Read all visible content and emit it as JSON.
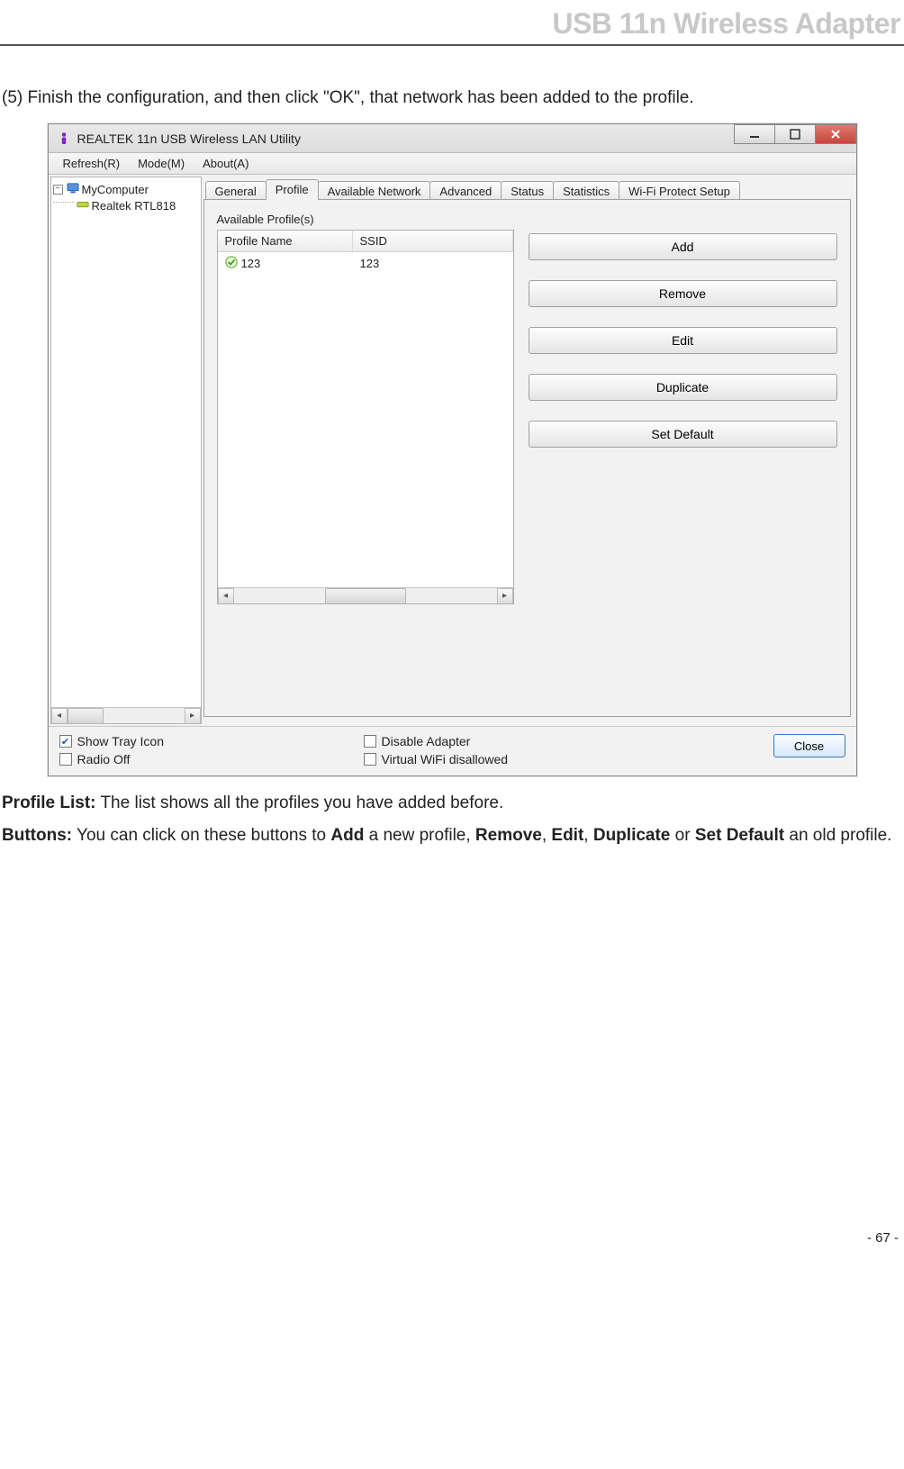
{
  "doc": {
    "header": "USB 11n Wireless Adapter",
    "step5": "(5) Finish the configuration, and then click \"OK\", that network has been added to the profile.",
    "profileListLabel": "Profile List:",
    "profileListText": " The list shows all the profiles you have added before.",
    "buttonsLabel": "Buttons:",
    "buttonsText1": " You can click on these buttons to ",
    "add": "Add",
    "buttonsText2": " a new profile, ",
    "remove": "Remove",
    "comma1": ", ",
    "edit": "Edit",
    "comma2": ", ",
    "duplicate": "Duplicate",
    "or": " or ",
    "setDefault": "Set Default",
    "buttonsText3": " an old profile.",
    "pageNumber": "- 67 -"
  },
  "app": {
    "title": "REALTEK 11n USB Wireless LAN Utility",
    "menus": {
      "refresh": "Refresh(R)",
      "mode": "Mode(M)",
      "about": "About(A)"
    },
    "tree": {
      "root": "MyComputer",
      "child": "Realtek RTL818"
    },
    "tabs": {
      "general": "General",
      "profile": "Profile",
      "available": "Available Network",
      "advanced": "Advanced",
      "status": "Status",
      "statistics": "Statistics",
      "wps": "Wi-Fi Protect Setup"
    },
    "sectionLabel": "Available Profile(s)",
    "listHeaders": {
      "name": "Profile Name",
      "ssid": "SSID"
    },
    "profiles": [
      {
        "name": "123",
        "ssid": "123"
      }
    ],
    "buttons": {
      "add": "Add",
      "remove": "Remove",
      "edit": "Edit",
      "duplicate": "Duplicate",
      "setDefault": "Set Default"
    },
    "checkboxes": {
      "showTrayIcon": {
        "label": "Show Tray Icon",
        "checked": true
      },
      "radioOff": {
        "label": "Radio Off",
        "checked": false
      },
      "disableAdapter": {
        "label": "Disable Adapter",
        "checked": false
      },
      "virtualWifi": {
        "label": "Virtual WiFi disallowed",
        "checked": false
      }
    },
    "closeLabel": "Close"
  }
}
